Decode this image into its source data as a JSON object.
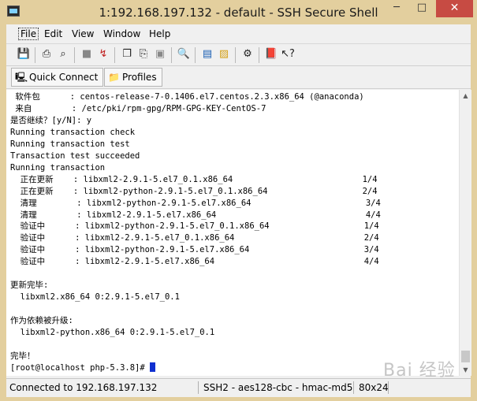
{
  "window": {
    "title": "1:192.168.197.132 - default - SSH Secure Shell",
    "minimize": "─",
    "maximize": "□",
    "close": "✕"
  },
  "menu": [
    "File",
    "Edit",
    "View",
    "Window",
    "Help"
  ],
  "toolbar_icons": [
    "save-icon",
    "print-icon",
    "print-preview-icon",
    "disconnect-icon",
    "new-connection-icon",
    "copy-icon",
    "paste-icon",
    "clear-icon",
    "find-icon",
    "new-terminal-icon",
    "new-file-transfer-icon",
    "settings-icon",
    "help-book-icon",
    "context-help-icon"
  ],
  "quickbar": {
    "quick_connect": "Quick Connect",
    "profiles": "Profiles"
  },
  "terminal": {
    "lines": [
      " 软件包      : centos-release-7-0.1406.el7.centos.2.3.x86_64 (@anaconda)",
      " 来自        : /etc/pki/rpm-gpg/RPM-GPG-KEY-CentOS-7",
      "是否继续？[y/N]: y",
      "Running transaction check",
      "Running transaction test",
      "Transaction test succeeded",
      "Running transaction",
      "  正在更新    : libxml2-2.9.1-5.el7_0.1.x86_64                          1/4",
      "  正在更新    : libxml2-python-2.9.1-5.el7_0.1.x86_64                   2/4",
      "  清理        : libxml2-python-2.9.1-5.el7.x86_64                       3/4",
      "  清理        : libxml2-2.9.1-5.el7.x86_64                              4/4",
      "  验证中      : libxml2-python-2.9.1-5.el7_0.1.x86_64                   1/4",
      "  验证中      : libxml2-2.9.1-5.el7_0.1.x86_64                          2/4",
      "  验证中      : libxml2-python-2.9.1-5.el7.x86_64                       3/4",
      "  验证中      : libxml2-2.9.1-5.el7.x86_64                              4/4",
      "",
      "更新完毕:",
      "  libxml2.x86_64 0:2.9.1-5.el7_0.1",
      "",
      "作为依赖被升级:",
      "  libxml2-python.x86_64 0:2.9.1-5.el7_0.1",
      "",
      "完毕！"
    ],
    "prompt": "[root@localhost php-5.3.8]# "
  },
  "status": {
    "connection": "Connected to 192.168.197.132",
    "cipher": "SSH2 - aes128-cbc - hmac-md5",
    "size": "80x24"
  },
  "watermark": "Bai 经验"
}
